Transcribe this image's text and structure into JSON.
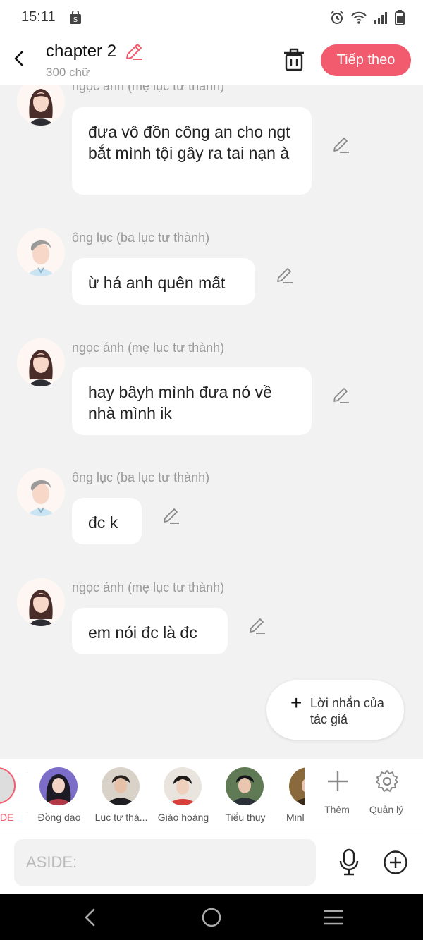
{
  "status_bar": {
    "time": "15:11"
  },
  "header": {
    "title": "chapter 2",
    "word_count": "300 chữ",
    "next_label": "Tiếp theo",
    "accent_color": "#f25a6d"
  },
  "messages": [
    {
      "name": "ngọc ánh (mẹ lục tư thành)",
      "text": "đưa vô đồn công an cho ngt bắt mình tội gây ra tai nạn à",
      "avatar": "woman"
    },
    {
      "name": "ông lục (ba lục tư thành)",
      "text": "ừ há anh quên mất",
      "avatar": "man"
    },
    {
      "name": "ngọc ánh (mẹ lục tư thành)",
      "text": "hay bâyh mình đưa nó về nhà mình ik",
      "avatar": "woman"
    },
    {
      "name": "ông lục (ba lục tư thành)",
      "text": "đc k",
      "avatar": "man"
    },
    {
      "name": "ngọc ánh (mẹ lục tư thành)",
      "text": "em nói đc là đc",
      "avatar": "woman"
    }
  ],
  "author_note": {
    "label": "Lời nhắn của tác giả"
  },
  "characters": {
    "aside_label": "DE",
    "items": [
      {
        "label": "Đồng dao"
      },
      {
        "label": "Lục tư thà..."
      },
      {
        "label": "Giáo hoàng"
      },
      {
        "label": "Tiểu thụy"
      },
      {
        "label": "Minl"
      }
    ],
    "add_label": "Thêm",
    "manage_label": "Quản lý"
  },
  "input": {
    "placeholder": "ASIDE:"
  }
}
